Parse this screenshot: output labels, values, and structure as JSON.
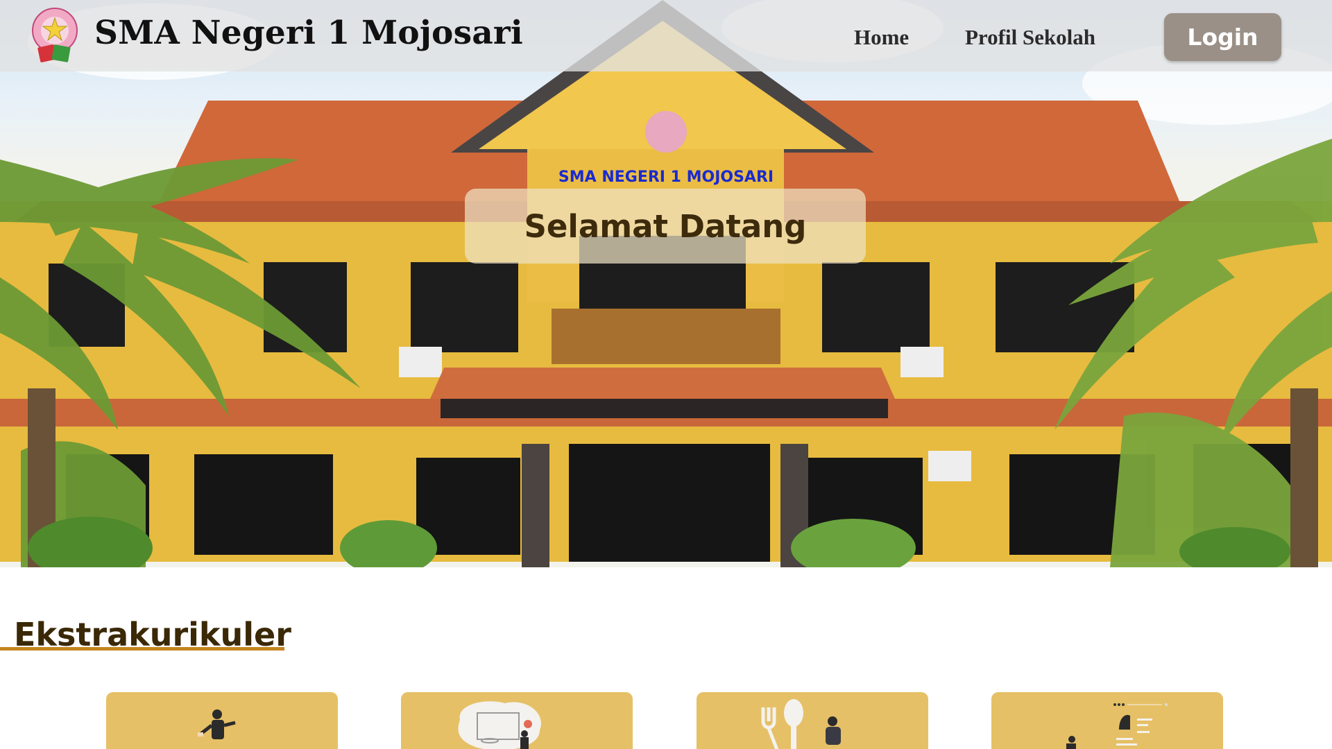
{
  "header": {
    "site_title": "SMA Negeri 1 Mojosari",
    "logo_icon": "school-logo-icon",
    "nav": [
      {
        "label": "Home"
      },
      {
        "label": "Profil Sekolah"
      }
    ],
    "login_label": "Login",
    "login_color": "#9a9087"
  },
  "hero": {
    "welcome": "Selamat Datang",
    "building_sign": "SMA NEGERI 1 MOJOSARI"
  },
  "section": {
    "title": "Ekstrakurikuler",
    "accent": "#c4851f",
    "card_color": "#e6c066",
    "cards": [
      {
        "icon": "martial-arts-illustration-icon"
      },
      {
        "icon": "basketball-illustration-icon"
      },
      {
        "icon": "cooking-illustration-icon"
      },
      {
        "icon": "social-media-illustration-icon"
      }
    ]
  }
}
